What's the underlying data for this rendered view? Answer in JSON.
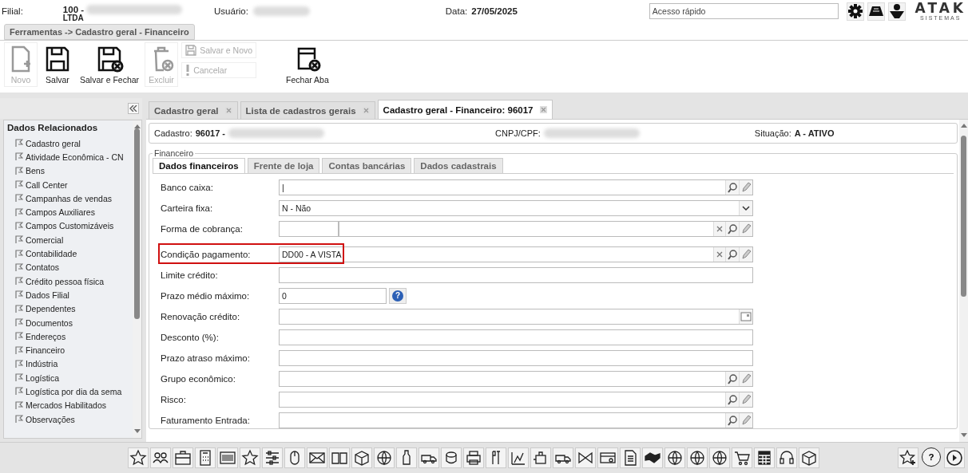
{
  "header": {
    "filial_label": "Filial:",
    "filial_value": "100 -",
    "filial_value_2": "LTDA",
    "user_label": "Usuário:",
    "date_label": "Data:",
    "date_value": "27/05/2025",
    "breadcrumb": "Ferramentas -> Cadastro geral - Financeiro",
    "quick_access": {
      "placeholder": "Acesso rápido"
    },
    "logo": "ATAK",
    "logo_sub": "SISTEMAS"
  },
  "toolbar": [
    {
      "kind": "large",
      "label": "Novo",
      "disabled": true
    },
    {
      "kind": "large",
      "label": "Salvar",
      "disabled": false
    },
    {
      "kind": "large",
      "label": "Salvar e Fechar",
      "disabled": false
    },
    {
      "kind": "large",
      "label": "Excluir",
      "disabled": true
    },
    {
      "kind": "stack",
      "items": [
        {
          "label": "Salvar e Novo",
          "disabled": true
        },
        {
          "label": "Cancelar",
          "disabled": true
        }
      ]
    },
    {
      "kind": "large",
      "label": "Fechar Aba",
      "disabled": false
    }
  ],
  "sidebar": {
    "title": "Dados Relacionados",
    "items": [
      "Cadastro geral",
      "Atividade Econômica - CN",
      "Bens",
      "Call Center",
      "Campanhas de vendas",
      "Campos Auxiliares",
      "Campos Customizáveis",
      "Comercial",
      "Contabilidade",
      "Contatos",
      "Crédito pessoa física",
      "Dados Filial",
      "Dependentes",
      "Documentos",
      "Endereços",
      "Financeiro",
      "Indústria",
      "Logística",
      "Logística por dia da sema",
      "Mercados Habilitados",
      "Observações"
    ]
  },
  "tabs": [
    {
      "label": "Cadastro geral",
      "selected": false
    },
    {
      "label": "Lista de cadastros gerais",
      "selected": false
    },
    {
      "label": "Cadastro geral - Financeiro: 96017",
      "selected": true
    }
  ],
  "record": {
    "cadastro_label": "Cadastro:",
    "cadastro_value": "96017 -",
    "cnpj_label": "CNPJ/CPF:",
    "situacao_label": "Situação:",
    "situacao_value": "A - ATIVO"
  },
  "section": {
    "legend": "Financeiro",
    "tabs": [
      {
        "label": "Dados financeiros",
        "selected": true
      },
      {
        "label": "Frente de loja",
        "selected": false
      },
      {
        "label": "Contas bancárias",
        "selected": false
      },
      {
        "label": "Dados cadastrais",
        "selected": false
      }
    ]
  },
  "fields": [
    {
      "label": "Banco caixa:",
      "kind": "lookup",
      "value": "|"
    },
    {
      "label": "Carteira fixa:",
      "kind": "select",
      "value": "N - Não"
    },
    {
      "label": "Forma de cobrança:",
      "kind": "double",
      "clear": true
    },
    {
      "label": "Condição pagamento:",
      "kind": "lookup",
      "value": "DD00 - A VISTA",
      "clear": true,
      "highlighted": true
    },
    {
      "label": "Limite crédito:",
      "kind": "text"
    },
    {
      "label": "Prazo médio máximo:",
      "kind": "help",
      "value": "0",
      "help_glyph": "?"
    },
    {
      "label": "Renovação crédito:",
      "kind": "date"
    },
    {
      "label": "Desconto (%):",
      "kind": "text"
    },
    {
      "label": "Prazo atraso máximo:",
      "kind": "text"
    },
    {
      "label": "Grupo econômico:",
      "kind": "lookup"
    },
    {
      "label": "Risco:",
      "kind": "lookup"
    },
    {
      "label": "Faturamento Entrada:",
      "kind": "lookup"
    }
  ],
  "dock": {
    "help_glyph": "?"
  }
}
